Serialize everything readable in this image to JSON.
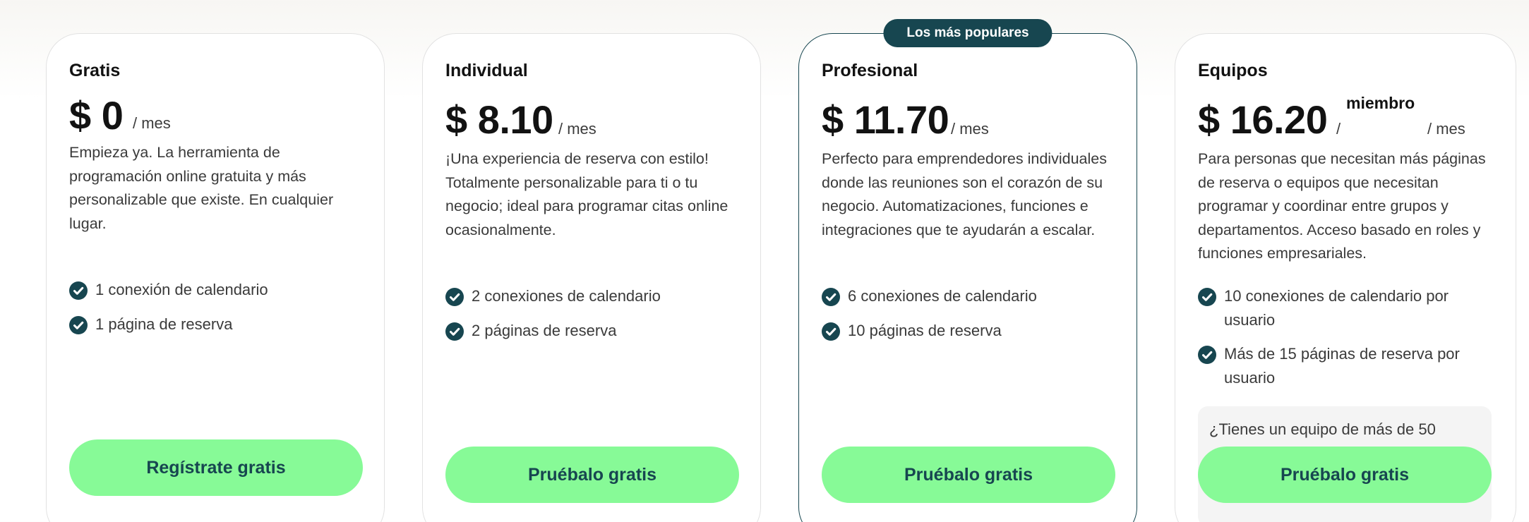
{
  "plans": [
    {
      "name": "Gratis",
      "price": "$ 0",
      "period": "/ mes",
      "description": "Empieza ya. La herramienta de programación online gratuita y más personalizable que existe. En cualquier lugar.",
      "features": [
        "1 conexión de calendario",
        "1 página de reserva"
      ],
      "cta": "Regístrate gratis"
    },
    {
      "name": "Individual",
      "price": "$ 8.10",
      "period": "/ mes",
      "description": "¡Una experiencia de reserva con estilo! Totalmente personalizable para ti o tu negocio; ideal para programar citas online ocasionalmente.",
      "features": [
        "2 conexiones de calendario",
        "2 páginas de reserva"
      ],
      "cta": "Pruébalo gratis"
    },
    {
      "badge": "Los más populares",
      "name": "Profesional",
      "price": "$ 11.70",
      "period": "/ mes",
      "description": "Perfecto para emprendedores individuales donde las reuniones son el corazón de su negocio. Automatizaciones, funciones e integraciones que te ayudarán a escalar.",
      "features": [
        "6 conexiones de calendario",
        "10 páginas de reserva"
      ],
      "cta": "Pruébalo gratis"
    },
    {
      "name": "Equipos",
      "price": "$ 16.20",
      "slash": "/",
      "member": "miembro",
      "period": "/ mes",
      "description": "Para personas que necesitan más páginas de reserva o equipos que necesitan programar y coordinar entre grupos y departamentos. Acceso basado en roles y funciones empresariales.",
      "features": [
        "10 conexiones de calendario por usuario",
        "Más de 15 páginas de reserva por usuario"
      ],
      "enterprise_note": "¿Tienes un equipo de más de 50",
      "cta": "Pruébalo gratis"
    }
  ],
  "colors": {
    "accent_dark": "#174650",
    "cta_green": "#87fa97",
    "card_border": "#e2e2e2"
  },
  "icons": {
    "feature_bullet": "check-circle-icon"
  }
}
